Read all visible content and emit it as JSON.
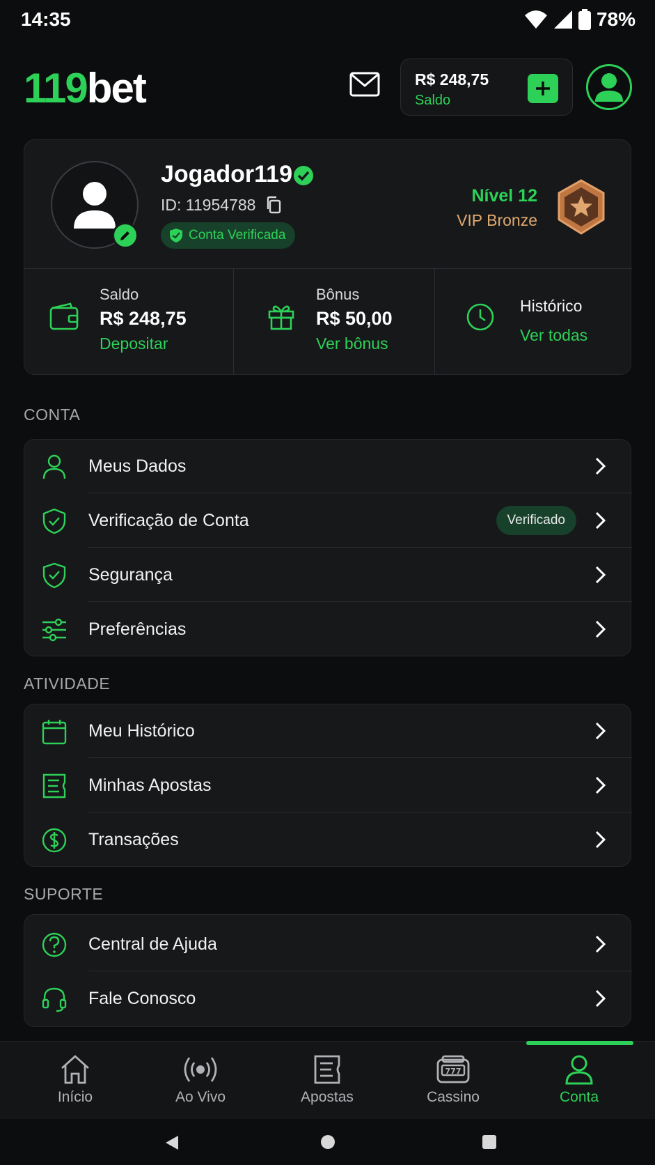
{
  "status": {
    "time": "14:35",
    "battery": "78%"
  },
  "header": {
    "logo_num": "119",
    "logo_txt": "bet",
    "balance_amount": "R$ 248,75",
    "balance_label": "Saldo"
  },
  "profile": {
    "name": "Jogador119",
    "id": "ID: 11954788",
    "verified": "Conta Verificada",
    "level": "Nível 12",
    "vip": "VIP Bronze"
  },
  "stats": [
    {
      "label": "Saldo",
      "value": "R$ 248,75",
      "link": "Depositar",
      "icon": "wallet-icon"
    },
    {
      "label": "Bônus",
      "value": "R$ 50,00",
      "link": "Ver bônus",
      "icon": "gift-icon"
    },
    {
      "label": "Histórico",
      "value": "",
      "link": "Ver todas",
      "icon": "clock-icon"
    }
  ],
  "sections": {
    "conta": {
      "title": "CONTA",
      "items": [
        {
          "label": "Meus Dados",
          "icon": "user-icon"
        },
        {
          "label": "Verificação de Conta",
          "icon": "shield-lock-icon",
          "badge": "Verificado"
        },
        {
          "label": "Segurança",
          "icon": "shield-check-icon"
        },
        {
          "label": "Preferências",
          "icon": "sliders-icon"
        }
      ]
    },
    "atividade": {
      "title": "ATIVIDADE",
      "items": [
        {
          "label": "Meu Histórico",
          "icon": "calendar-icon"
        },
        {
          "label": "Minhas Apostas",
          "icon": "ticket-icon"
        },
        {
          "label": "Transações",
          "icon": "dollar-icon"
        }
      ]
    },
    "suporte": {
      "title": "SUPORTE",
      "items": [
        {
          "label": "Central de Ajuda",
          "icon": "help-icon"
        },
        {
          "label": "Fale Conosco",
          "icon": "headset-icon"
        }
      ]
    }
  },
  "nav": [
    {
      "label": "Início",
      "icon": "home-icon"
    },
    {
      "label": "Ao Vivo",
      "icon": "live-icon"
    },
    {
      "label": "Apostas",
      "icon": "bets-icon"
    },
    {
      "label": "Cassino",
      "icon": "slot-icon"
    },
    {
      "label": "Conta",
      "icon": "account-icon",
      "active": true
    }
  ],
  "colors": {
    "accent": "#2ed158",
    "background": "#0c0d0e",
    "card": "#16181a",
    "vip": "#e0a870"
  }
}
